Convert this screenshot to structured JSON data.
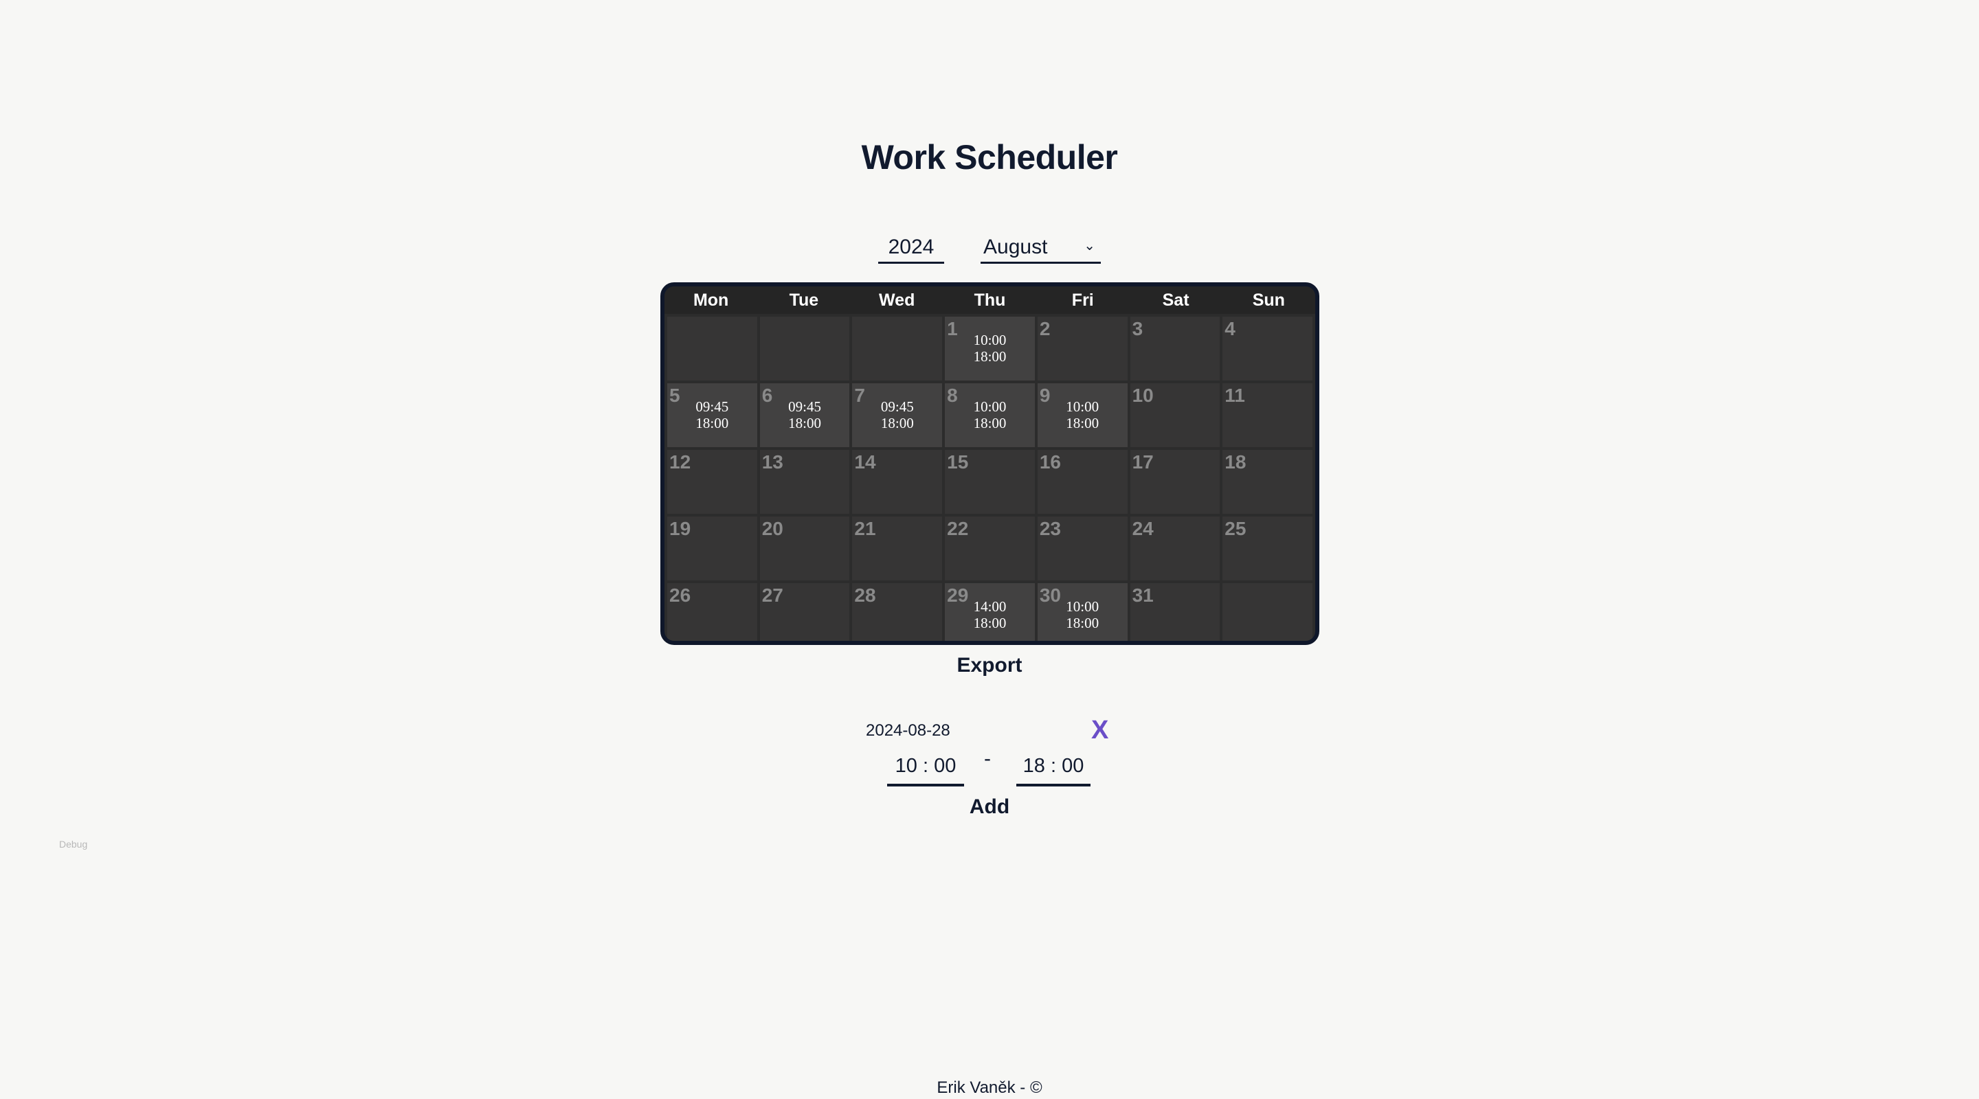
{
  "title": "Work Scheduler",
  "controls": {
    "year": "2024",
    "month": "August",
    "chevron": "⌄"
  },
  "calendar": {
    "weekdays": [
      "Mon",
      "Tue",
      "Wed",
      "Thu",
      "Fri",
      "Sat",
      "Sun"
    ],
    "cells": [
      {
        "day": "",
        "start": "",
        "end": ""
      },
      {
        "day": "",
        "start": "",
        "end": ""
      },
      {
        "day": "",
        "start": "",
        "end": ""
      },
      {
        "day": "1",
        "start": "10:00",
        "end": "18:00"
      },
      {
        "day": "2",
        "start": "",
        "end": ""
      },
      {
        "day": "3",
        "start": "",
        "end": ""
      },
      {
        "day": "4",
        "start": "",
        "end": ""
      },
      {
        "day": "5",
        "start": "09:45",
        "end": "18:00"
      },
      {
        "day": "6",
        "start": "09:45",
        "end": "18:00"
      },
      {
        "day": "7",
        "start": "09:45",
        "end": "18:00"
      },
      {
        "day": "8",
        "start": "10:00",
        "end": "18:00"
      },
      {
        "day": "9",
        "start": "10:00",
        "end": "18:00"
      },
      {
        "day": "10",
        "start": "",
        "end": ""
      },
      {
        "day": "11",
        "start": "",
        "end": ""
      },
      {
        "day": "12",
        "start": "",
        "end": ""
      },
      {
        "day": "13",
        "start": "",
        "end": ""
      },
      {
        "day": "14",
        "start": "",
        "end": ""
      },
      {
        "day": "15",
        "start": "",
        "end": ""
      },
      {
        "day": "16",
        "start": "",
        "end": ""
      },
      {
        "day": "17",
        "start": "",
        "end": ""
      },
      {
        "day": "18",
        "start": "",
        "end": ""
      },
      {
        "day": "19",
        "start": "",
        "end": ""
      },
      {
        "day": "20",
        "start": "",
        "end": ""
      },
      {
        "day": "21",
        "start": "",
        "end": ""
      },
      {
        "day": "22",
        "start": "",
        "end": ""
      },
      {
        "day": "23",
        "start": "",
        "end": ""
      },
      {
        "day": "24",
        "start": "",
        "end": ""
      },
      {
        "day": "25",
        "start": "",
        "end": ""
      },
      {
        "day": "26",
        "start": "",
        "end": ""
      },
      {
        "day": "27",
        "start": "",
        "end": ""
      },
      {
        "day": "28",
        "start": "",
        "end": ""
      },
      {
        "day": "29",
        "start": "14:00",
        "end": "18:00"
      },
      {
        "day": "30",
        "start": "10:00",
        "end": "18:00"
      },
      {
        "day": "31",
        "start": "",
        "end": ""
      },
      {
        "day": "",
        "start": "",
        "end": ""
      }
    ]
  },
  "export_label": "Export",
  "editor": {
    "date": "2024-08-28",
    "close": "X",
    "start": "10 : 00",
    "dash": "-",
    "end": "18 : 00",
    "add_label": "Add"
  },
  "debug_label": "Debug",
  "footer": "Erik Vaněk - ©",
  "colors": {
    "accent": "#6b4fc8",
    "navy": "#0f172a"
  }
}
